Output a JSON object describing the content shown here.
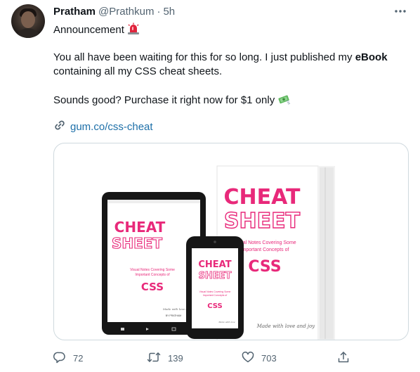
{
  "tweet": {
    "author_name": "Pratham",
    "handle": "@Prathkum",
    "separator": "·",
    "time": "5h",
    "line1": "Announcement",
    "line2_pre": "You all have been waiting for this for so long. I just published my ",
    "line2_bold": "eBook",
    "line3": "containing all my CSS cheat sheets.",
    "line4": "Sounds good? Purchase it right now for $1 only",
    "link": "gum.co/css-cheat"
  },
  "media": {
    "tablet": {
      "cheat": "CHEAT",
      "sheet": "SHEET",
      "sub1": "Visual Notes Covering Some",
      "sub2": "Important Concepts of",
      "topic": "CSS",
      "byline": "BY PRATHAM",
      "sign": "Made with love and"
    },
    "phone": {
      "cheat": "CHEAT",
      "sheet": "SHEET",
      "sub1": "Visual Notes Covering Some",
      "sub2": "Important Concepts of",
      "topic": "CSS",
      "sign": "Made with love"
    },
    "book": {
      "cheat": "CHEAT",
      "sheet": "SHEET",
      "sub1": "Visual Notes Covering Some",
      "sub2": "Important Concepts of",
      "topic": "CSS",
      "sign": "Made with love and joy"
    }
  },
  "actions": {
    "replies": "72",
    "retweets": "139",
    "likes": "703"
  },
  "colors": {
    "accent_pink": "#e8297a",
    "link_blue": "#1d6fa8",
    "muted": "#536471"
  },
  "icons": [
    "siren-emoji",
    "money-emoji",
    "link-icon",
    "more-icon",
    "reply-icon",
    "retweet-icon",
    "like-icon",
    "share-icon"
  ]
}
